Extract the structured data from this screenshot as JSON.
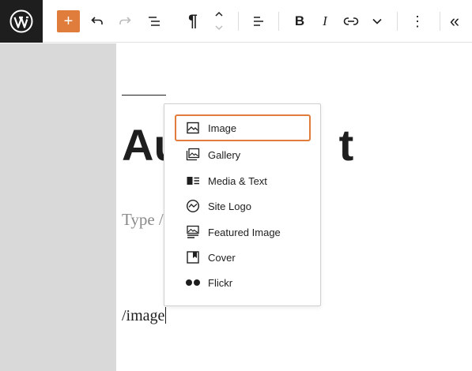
{
  "toolbar": {
    "logo_icon": "wordpress-logo-icon",
    "inserter_symbol": "+",
    "paragraph_symbol": "¶",
    "bold_label": "B",
    "italic_label": "I",
    "more_symbol": "⋮",
    "collapse_symbol": "«"
  },
  "editor": {
    "title_visible": "Au",
    "title_visible_end": "t",
    "placeholder_visible": "Type /",
    "typed_text": "/image"
  },
  "inserter_menu": {
    "items": [
      {
        "label": "Image",
        "icon": "image-icon",
        "selected": true
      },
      {
        "label": "Gallery",
        "icon": "gallery-icon",
        "selected": false
      },
      {
        "label": "Media & Text",
        "icon": "media-text-icon",
        "selected": false
      },
      {
        "label": "Site Logo",
        "icon": "site-logo-icon",
        "selected": false
      },
      {
        "label": "Featured Image",
        "icon": "featured-image-icon",
        "selected": false
      },
      {
        "label": "Cover",
        "icon": "cover-icon",
        "selected": false
      },
      {
        "label": "Flickr",
        "icon": "flickr-icon",
        "selected": false
      }
    ]
  },
  "colors": {
    "accent": "#e07c3c",
    "dark": "#1e1e1e",
    "sidebar": "#d9d9d9"
  }
}
